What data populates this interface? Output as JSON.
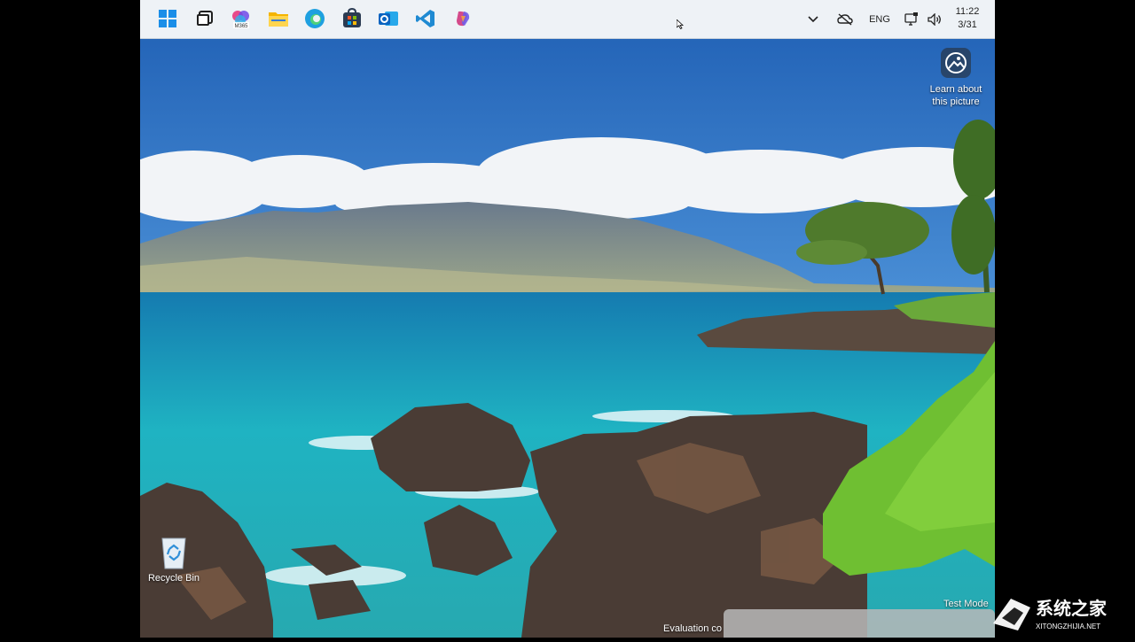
{
  "taskbar": {
    "apps": [
      {
        "name": "start-button",
        "icon": "windows-logo-icon"
      },
      {
        "name": "task-view-button",
        "icon": "task-view-icon"
      },
      {
        "name": "m365-button",
        "icon": "microsoft-365-icon",
        "badge": "M365"
      },
      {
        "name": "file-explorer-button",
        "icon": "folder-icon"
      },
      {
        "name": "edge-button",
        "icon": "edge-icon"
      },
      {
        "name": "store-button",
        "icon": "store-icon"
      },
      {
        "name": "outlook-button",
        "icon": "outlook-icon"
      },
      {
        "name": "vscode-button",
        "icon": "vscode-icon"
      },
      {
        "name": "copilot-button",
        "icon": "copilot-icon"
      }
    ],
    "tray": {
      "language": "ENG",
      "time": "11:22",
      "date": "3/31"
    }
  },
  "desktop": {
    "learn_line1": "Learn about",
    "learn_line2": "this picture",
    "recycle_bin": "Recycle Bin",
    "evaluation_text": "Evaluation co",
    "test_mode": "Test Mode"
  },
  "watermark": {
    "brand": "系统之家",
    "url": "XITONGZHIJIA.NET"
  },
  "colors": {
    "sky": "#2a6fc0",
    "sea": "#1fb3c2",
    "taskbar": "#eef2f6"
  }
}
